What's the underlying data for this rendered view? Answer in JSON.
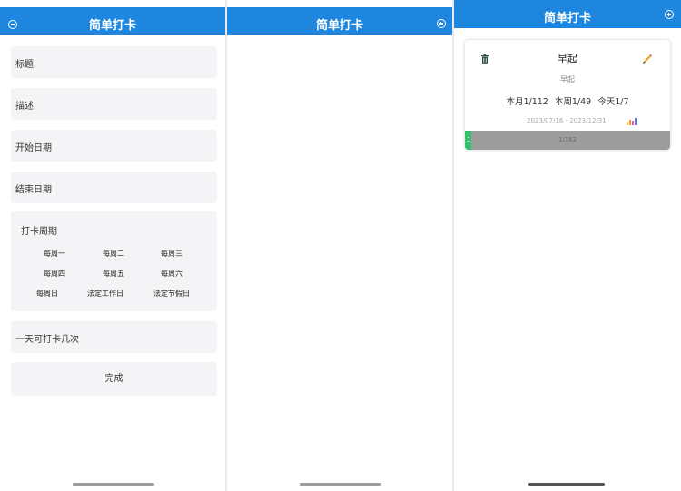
{
  "app_title": "简单打卡",
  "colors": {
    "header": "#1e86de",
    "field_bg": "#f4f4f6",
    "progress_fill": "#33c06c",
    "progress_track": "#9d9d9d"
  },
  "screen1": {
    "header_left_icon": "minus-circle-icon",
    "fields": {
      "title": "标题",
      "description": "描述",
      "start_date": "开始日期",
      "end_date": "结束日期",
      "times_per_day": "一天可打卡几次"
    },
    "period": {
      "label": "打卡周期",
      "options": [
        "每周一",
        "每周二",
        "每周三",
        "每周四",
        "每周五",
        "每周六",
        "每周日",
        "法定工作日",
        "法定节假日"
      ]
    },
    "done_label": "完成"
  },
  "screen2": {
    "header_right_icon": "plus-circle-icon"
  },
  "screen3": {
    "header_right_icon": "plus-circle-icon",
    "card": {
      "title": "早起",
      "subtitle": "早起",
      "stats": {
        "month": "本月1/112",
        "week": "本周1/49",
        "today": "今天1/7"
      },
      "date_range": "2023/07/16 - 2023/12/31",
      "progress_start": "1",
      "progress_text": "1/162",
      "progress_fraction": 0.006,
      "icons": {
        "delete": "trash-icon",
        "edit": "pencil-icon",
        "stats": "bar-chart-icon"
      }
    }
  }
}
